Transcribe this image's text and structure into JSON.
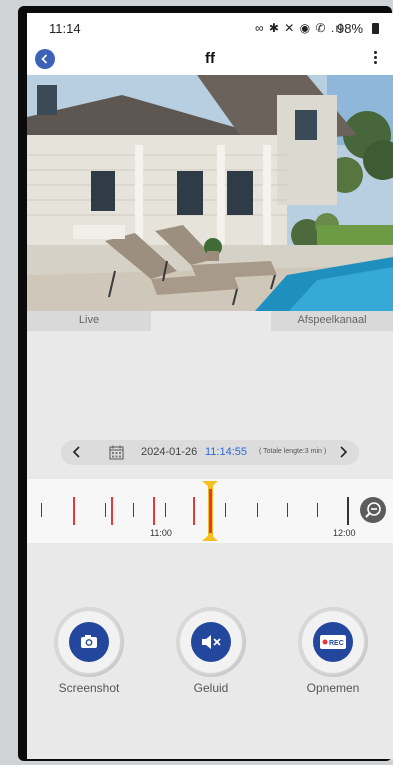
{
  "status_bar": {
    "time": "11:14",
    "icons": "∞ ✱ ✕ ◉ ✆ .ıl",
    "battery_pct": "98%"
  },
  "header": {
    "title": "ff"
  },
  "tabs": {
    "live": "Live",
    "playback": "Afspeelkanaal"
  },
  "date_bar": {
    "date": "2024-01-26",
    "time": "11:14:55",
    "length": "( Totale lengte:3 min )"
  },
  "timeline": {
    "labels": [
      "11:00",
      "12:00"
    ],
    "recording_color": "#e03a3a",
    "cursor_color": "#f4c020"
  },
  "controls": {
    "screenshot": "Screenshot",
    "sound": "Geluid",
    "record": "Opnemen",
    "record_badge": "REC"
  },
  "colors": {
    "accent": "#22479c",
    "time_highlight": "#2c68d6"
  }
}
